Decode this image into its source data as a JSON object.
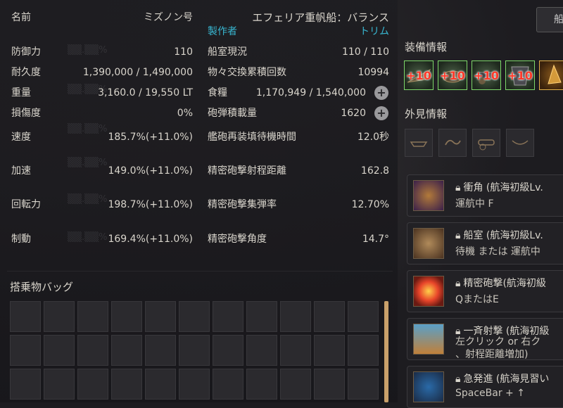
{
  "ship": {
    "name_label": "名前",
    "name_value": "ミズノン号",
    "type_value": "エフェリア重帆船：バランス",
    "maker_label": "製作者",
    "maker_value": "トリム"
  },
  "left_stats": [
    {
      "label": "防御力",
      "value": "110"
    },
    {
      "label": "耐久度",
      "value": "1,390,000 / 1,490,000"
    },
    {
      "label": "重量",
      "value": "3,160.0 / 19,550 LT"
    },
    {
      "label": "損傷度",
      "value": "0%"
    },
    {
      "label": "速度",
      "value": "185.7%(+11.0%)"
    },
    {
      "label": "加速",
      "value": "149.0%(+11.0%)"
    },
    {
      "label": "回転力",
      "value": "198.7%(+11.0%)"
    },
    {
      "label": "制動",
      "value": "169.4%(+11.0%)"
    }
  ],
  "right_stats": [
    {
      "label": "船室現況",
      "value": "110 / 110"
    },
    {
      "label": "物々交換累積回数",
      "value": "10994"
    },
    {
      "label": "食糧",
      "value": "1,170,949 / 1,540,000"
    },
    {
      "label": "砲弾積載量",
      "value": "1620"
    },
    {
      "label": "艦砲再装填待機時間",
      "value": "12.0秒"
    },
    {
      "label": "精密砲撃射程距離",
      "value": "162.8"
    },
    {
      "label": "精密砲撃集弾率",
      "value": "12.70%"
    },
    {
      "label": "精密砲撃角度",
      "value": "14.7°"
    }
  ],
  "plus_symbol": "+",
  "bag": {
    "title": "搭乗物バッグ",
    "slot_count": 33
  },
  "top_button": {
    "label": "船"
  },
  "equipment": {
    "title": "装備情報",
    "items": [
      {
        "level": "+10",
        "icon": "ship-bow-icon"
      },
      {
        "level": "+10",
        "icon": "ship-figurehead-icon"
      },
      {
        "level": "+10",
        "icon": "cannon-icon"
      },
      {
        "level": "+10",
        "icon": "ship-plating-icon"
      },
      {
        "level": "",
        "icon": "gold-equipment-icon"
      }
    ]
  },
  "appearance": {
    "title": "外見情報",
    "items": [
      {
        "icon": "hull-decoration-icon"
      },
      {
        "icon": "flag-decoration-icon"
      },
      {
        "icon": "cannon-decoration-icon"
      },
      {
        "icon": "sail-decoration-icon"
      }
    ]
  },
  "skills": [
    {
      "name": "衝角 (航海初級Lv.",
      "key": "運航中 F",
      "icon": "ram-skill-icon"
    },
    {
      "name": "船室 (航海初級Lv.",
      "key": "待機 または 運航中",
      "icon": "cabin-skill-icon"
    },
    {
      "name": "精密砲撃(航海初級",
      "key": "QまたはE",
      "icon": "precision-fire-icon"
    },
    {
      "name": "一斉射撃 (航海初級",
      "key": "左クリック or 右ク",
      "key2": "、射程距離増加)",
      "icon": "broadside-icon"
    },
    {
      "name": "急発進 (航海見習い",
      "key": "SpaceBar + ↑",
      "icon": "quick-start-icon"
    }
  ],
  "colors": {
    "accent_cyan": "#38b6d0",
    "equip_border": "#7ed86a",
    "scroll_thumb": "#c9a06a"
  }
}
